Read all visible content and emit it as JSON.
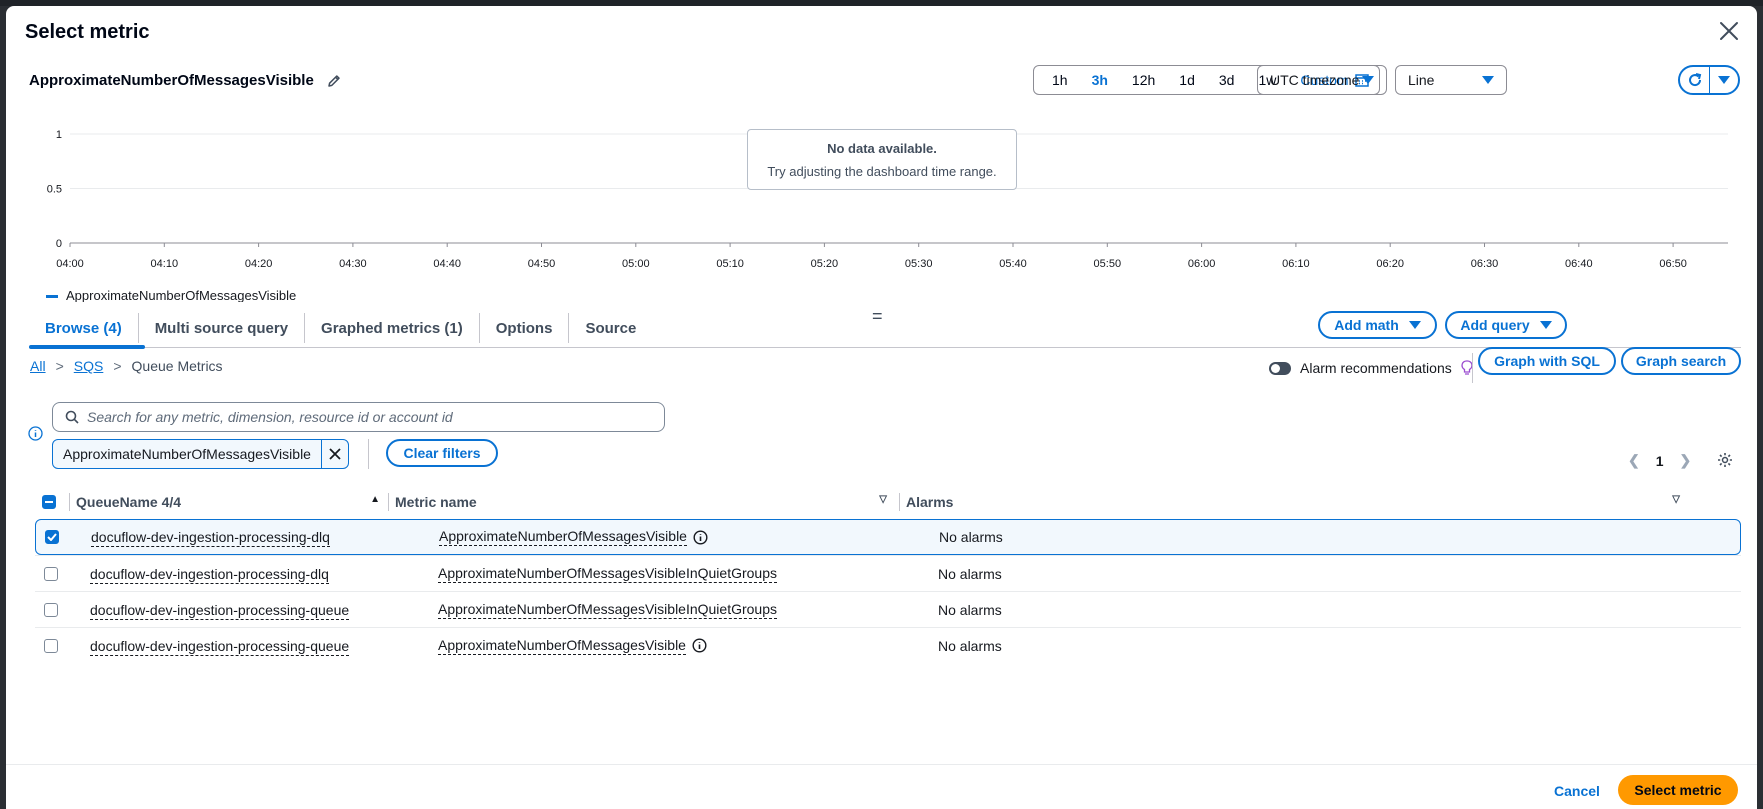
{
  "modal": {
    "title": "Select metric",
    "metric_title": "ApproximateNumberOfMessagesVisible"
  },
  "time_range": {
    "options": [
      "1h",
      "3h",
      "12h",
      "1d",
      "3d",
      "1w"
    ],
    "active": "3h",
    "custom_label": "Custom"
  },
  "timezone": {
    "selected": "UTC timezone"
  },
  "chart_type": {
    "selected": "Line"
  },
  "chart": {
    "y_ticks": [
      "1",
      "0.5",
      "0"
    ],
    "x_ticks": [
      "04:00",
      "04:10",
      "04:20",
      "04:30",
      "04:40",
      "04:50",
      "05:00",
      "05:10",
      "05:20",
      "05:30",
      "05:40",
      "05:50",
      "06:00",
      "06:10",
      "06:20",
      "06:30",
      "06:40",
      "06:50"
    ],
    "nodata_title": "No data available.",
    "nodata_sub": "Try adjusting the dashboard time range.",
    "legend": "ApproximateNumberOfMessagesVisible",
    "colors": {
      "series": "#0972d3"
    }
  },
  "tabs": [
    {
      "label": "Browse (4)",
      "active": true
    },
    {
      "label": "Multi source query"
    },
    {
      "label": "Graphed metrics (1)"
    },
    {
      "label": "Options"
    },
    {
      "label": "Source"
    }
  ],
  "actions": {
    "add_math": "Add math",
    "add_query": "Add query",
    "graph_with_sql": "Graph with SQL",
    "graph_search": "Graph search",
    "alarm_recommendations": "Alarm recommendations",
    "clear_filters": "Clear filters",
    "cancel": "Cancel",
    "select_metric": "Select metric"
  },
  "breadcrumb": {
    "all": "All",
    "sqs": "SQS",
    "current": "Queue Metrics"
  },
  "search": {
    "placeholder": "Search for any metric, dimension, resource id or account id"
  },
  "filter_token": "ApproximateNumberOfMessagesVisible",
  "pagination": {
    "page": "1"
  },
  "table": {
    "headers": {
      "queue": "QueueName 4/4",
      "metric": "Metric name",
      "alarms": "Alarms"
    },
    "rows": [
      {
        "queue": "docuflow-dev-ingestion-processing-dlq",
        "metric": "ApproximateNumberOfMessagesVisible",
        "alarms": "No alarms",
        "checked": true,
        "info": true
      },
      {
        "queue": "docuflow-dev-ingestion-processing-dlq",
        "metric": "ApproximateNumberOfMessagesVisibleInQuietGroups",
        "alarms": "No alarms",
        "checked": false,
        "info": false
      },
      {
        "queue": "docuflow-dev-ingestion-processing-queue",
        "metric": "ApproximateNumberOfMessagesVisibleInQuietGroups",
        "alarms": "No alarms",
        "checked": false,
        "info": false
      },
      {
        "queue": "docuflow-dev-ingestion-processing-queue",
        "metric": "ApproximateNumberOfMessagesVisible",
        "alarms": "No alarms",
        "checked": false,
        "info": true
      }
    ]
  }
}
